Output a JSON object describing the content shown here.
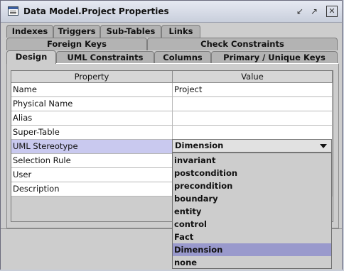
{
  "window": {
    "title": "Data Model.Project Properties"
  },
  "tabs": {
    "row1": [
      "Indexes",
      "Triggers",
      "Sub-Tables",
      "Links"
    ],
    "row2": [
      "Foreign Keys",
      "Check Constraints"
    ],
    "row3": [
      "Design",
      "UML Constraints",
      "Columns",
      "Primary / Unique Keys"
    ],
    "active": "Design"
  },
  "table": {
    "columns": [
      "Property",
      "Value"
    ],
    "rows": [
      {
        "property": "Name",
        "value": "Project"
      },
      {
        "property": "Physical Name",
        "value": ""
      },
      {
        "property": "Alias",
        "value": ""
      },
      {
        "property": "Super-Table",
        "value": ""
      },
      {
        "property": "UML Stereotype",
        "value": ""
      },
      {
        "property": "Selection Rule",
        "value": ""
      },
      {
        "property": "User",
        "value": ""
      },
      {
        "property": "Description",
        "value": ""
      }
    ]
  },
  "stereotype_combo": {
    "selected": "Dimension",
    "options": [
      "invariant",
      "postcondition",
      "precondition",
      "boundary",
      "entity",
      "control",
      "Fact",
      "Dimension",
      "none"
    ],
    "highlighted": "Dimension"
  }
}
